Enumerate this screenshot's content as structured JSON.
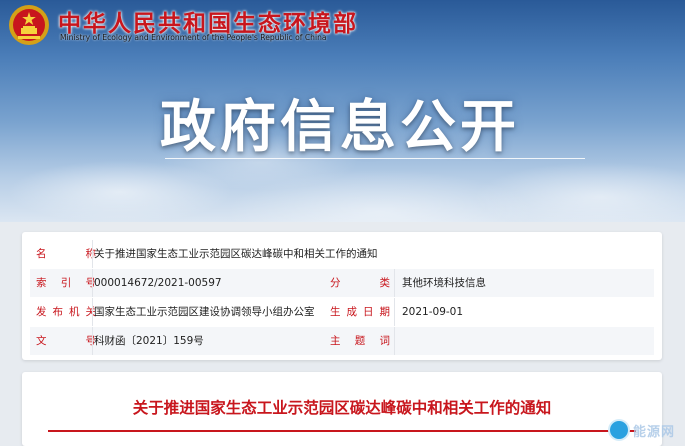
{
  "header": {
    "ministry_name_cn": "中华人民共和国生态环境部",
    "ministry_name_en": "Ministry of Ecology and Environment of the People's Republic of China",
    "banner_title": "政府信息公开",
    "emblem_icon": "national-emblem-icon"
  },
  "metadata": {
    "name_label": "名　　称",
    "name_value": "关于推进国家生态工业示范园区碳达峰碳中和相关工作的通知",
    "index_label": "索 引 号",
    "index_value": "000014672/2021-00597",
    "category_label": "分　　类",
    "category_value": "其他环境科技信息",
    "issuer_label": "发布机关",
    "issuer_value": "国家生态工业示范园区建设协调领导小组办公室",
    "date_label": "生成日期",
    "date_value": "2021-09-01",
    "doc_no_label": "文　　号",
    "doc_no_value": "科财函〔2021〕159号",
    "keywords_label": "主 题 词",
    "keywords_value": ""
  },
  "notice": {
    "title": "关于推进国家生态工业示范园区碳达峰碳中和相关工作的通知"
  },
  "watermark": {
    "text": "能源网",
    "logo_icon": "watermark-logo-icon"
  },
  "colors": {
    "accent_red": "#c8161d",
    "banner_blue": "#4a7db8"
  }
}
